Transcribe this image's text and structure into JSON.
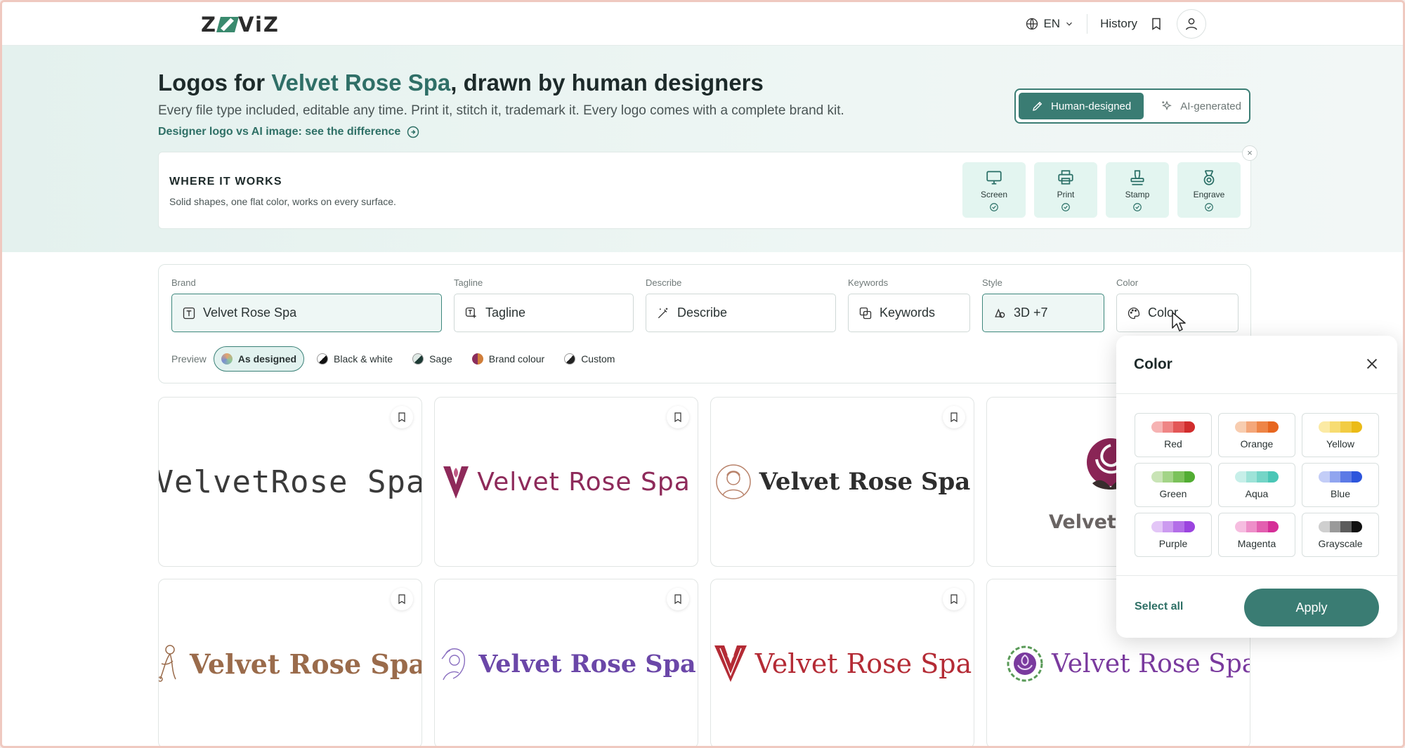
{
  "nav": {
    "logo_text_left": "Z",
    "logo_text_right": "ViZ",
    "lang_label": "EN",
    "history_label": "History"
  },
  "hero": {
    "title_prefix": "Logos for ",
    "brand_name": "Velvet Rose Spa",
    "title_suffix": ", drawn by human designers",
    "subtitle": "Every file type included, editable any time. Print it, stitch it, trademark it. Every logo comes with a complete brand kit.",
    "compare_link": "Designer logo vs AI image: see the difference",
    "toggle": {
      "human": "Human-designed",
      "ai": "AI-generated",
      "selected": "human"
    }
  },
  "where_it_works": {
    "title": "WHERE IT WORKS",
    "description": "Solid shapes, one flat color, works on every surface.",
    "close_label": "×",
    "tiles": [
      {
        "label": "Screen",
        "icon": "monitor-icon"
      },
      {
        "label": "Print",
        "icon": "printer-icon"
      },
      {
        "label": "Stamp",
        "icon": "stamp-icon"
      },
      {
        "label": "Engrave",
        "icon": "medal-icon"
      }
    ]
  },
  "search": {
    "brand": {
      "label": "Brand",
      "value": "Velvet Rose Spa"
    },
    "tagline": {
      "label": "Tagline",
      "placeholder": "Tagline"
    },
    "describe": {
      "label": "Describe",
      "placeholder": "Describe"
    },
    "keywords": {
      "label": "Keywords",
      "placeholder": "Keywords"
    },
    "style": {
      "label": "Style",
      "value": "3D +7"
    },
    "color": {
      "label": "Color",
      "placeholder": "Color"
    },
    "preview": {
      "label": "Preview",
      "options": [
        "As designed",
        "Black & white",
        "Sage",
        "Brand colour",
        "Custom"
      ],
      "selected": "As designed"
    }
  },
  "logos": [
    {
      "text": "VelvetRose Spa",
      "style": "mono-rose",
      "color": "#3a3a3a"
    },
    {
      "text": "Velvet Rose Spa",
      "style": "v-emblem",
      "color": "#8e2a5a"
    },
    {
      "text": "Velvet Rose Spa",
      "style": "portrait-slab",
      "color": "#2e2e2e"
    },
    {
      "text": "Velvet R",
      "style": "rose-badge",
      "color": "#6a6463"
    },
    {
      "text": "Velvet Rose Spa",
      "style": "figure-serif",
      "color": "#9a6b4b"
    },
    {
      "text": "Velvet Rose Spa",
      "style": "lady-purple",
      "color": "#6b47a8"
    },
    {
      "text": "Velvet Rose Spa",
      "style": "red-v",
      "color": "#b42b35"
    },
    {
      "text": "Velvet Rose Spa",
      "style": "wreath-purple",
      "color": "#7a3a9e"
    }
  ],
  "color_popover": {
    "title": "Color",
    "swatches": [
      {
        "name": "Red",
        "shades": [
          "#f6b3b3",
          "#ef8585",
          "#e35656",
          "#d12d2d"
        ]
      },
      {
        "name": "Orange",
        "shades": [
          "#f8cdb0",
          "#f4a77a",
          "#ee8547",
          "#e7661f"
        ]
      },
      {
        "name": "Yellow",
        "shades": [
          "#fbeaa4",
          "#f7dc72",
          "#f2cc43",
          "#ebbb17"
        ]
      },
      {
        "name": "Green",
        "shades": [
          "#c9e4b6",
          "#a3d487",
          "#7bc25a",
          "#52ad33"
        ]
      },
      {
        "name": "Aqua",
        "shades": [
          "#c7efe9",
          "#9ee3d8",
          "#74d5c7",
          "#4ac6b6"
        ]
      },
      {
        "name": "Blue",
        "shades": [
          "#c3cdf7",
          "#91a5ef",
          "#5c7ae6",
          "#2d55dc"
        ]
      },
      {
        "name": "Purple",
        "shades": [
          "#e3c6f7",
          "#cc9bf0",
          "#b36ee8",
          "#9b44df"
        ]
      },
      {
        "name": "Magenta",
        "shades": [
          "#f6bde0",
          "#ee8fc9",
          "#e35fb0",
          "#d52f97"
        ]
      },
      {
        "name": "Grayscale",
        "shades": [
          "#cfcfcf",
          "#9a9a9a",
          "#5c5c5c",
          "#111111"
        ]
      }
    ],
    "select_all": "Select all",
    "apply": "Apply"
  },
  "colors": {
    "accent": "#3a7c73",
    "brand_text": "#2f6f67"
  }
}
